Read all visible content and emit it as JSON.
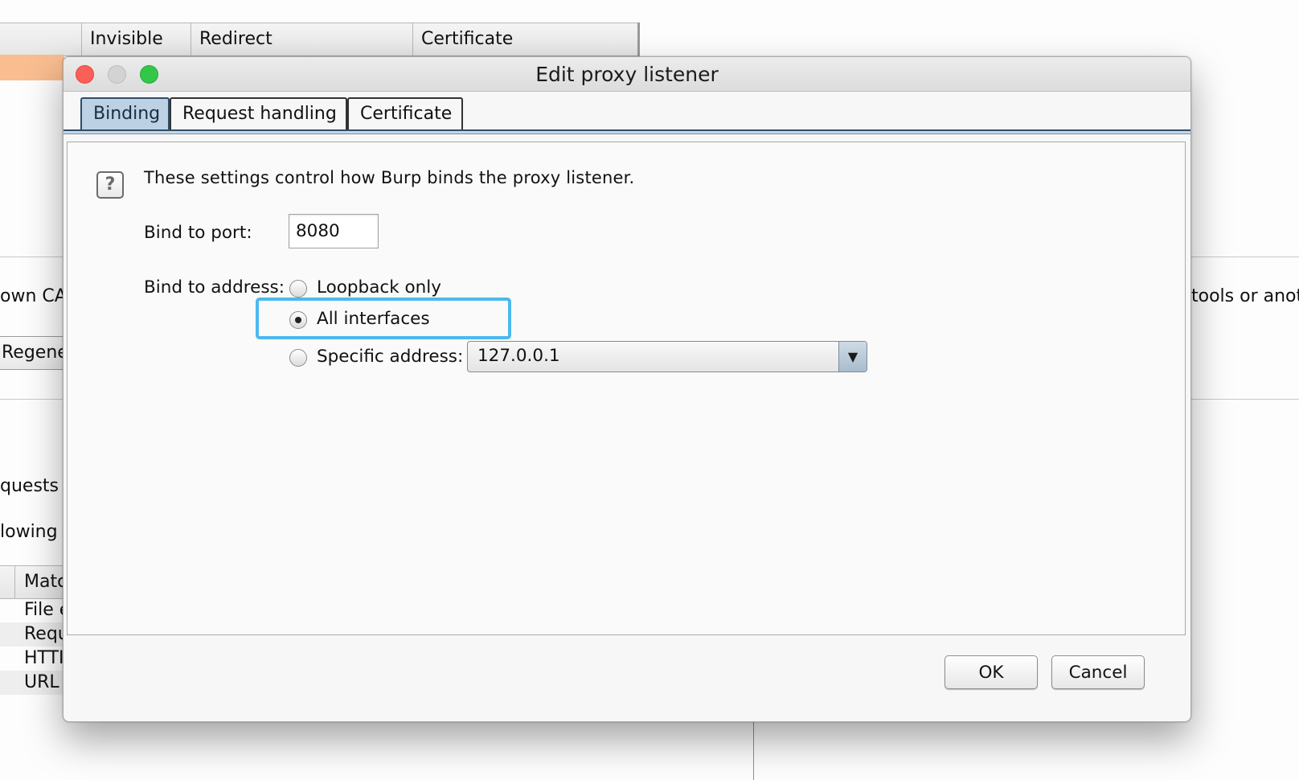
{
  "background": {
    "header_columns": [
      "Invisible",
      "Redirect",
      "Certificate"
    ],
    "left_fragments": [
      "own CA",
      "Regene",
      "quests a",
      "lowing"
    ],
    "right_fragment": "tools or anot",
    "table_header": "Matc",
    "table_rows": [
      "File e",
      "Requ",
      "HTTI",
      "URL"
    ],
    "selected_row_color": "#f9bd90"
  },
  "dialog": {
    "title": "Edit proxy listener",
    "tabs": [
      {
        "label": "Binding",
        "selected": true
      },
      {
        "label": "Request handling",
        "selected": false
      },
      {
        "label": "Certificate",
        "selected": false
      }
    ],
    "info_text": "These settings control how Burp binds the proxy listener.",
    "help_icon": "question-mark-icon",
    "port": {
      "label": "Bind to port:",
      "value": "8080"
    },
    "address": {
      "label": "Bind to address:",
      "options": [
        {
          "label": "Loopback only",
          "checked": false
        },
        {
          "label": "All interfaces",
          "checked": true
        },
        {
          "label": "Specific address:",
          "checked": false
        }
      ],
      "specific_value": "127.0.0.1"
    },
    "buttons": {
      "ok": "OK",
      "cancel": "Cancel"
    },
    "highlight_color": "#4ab9ef"
  }
}
